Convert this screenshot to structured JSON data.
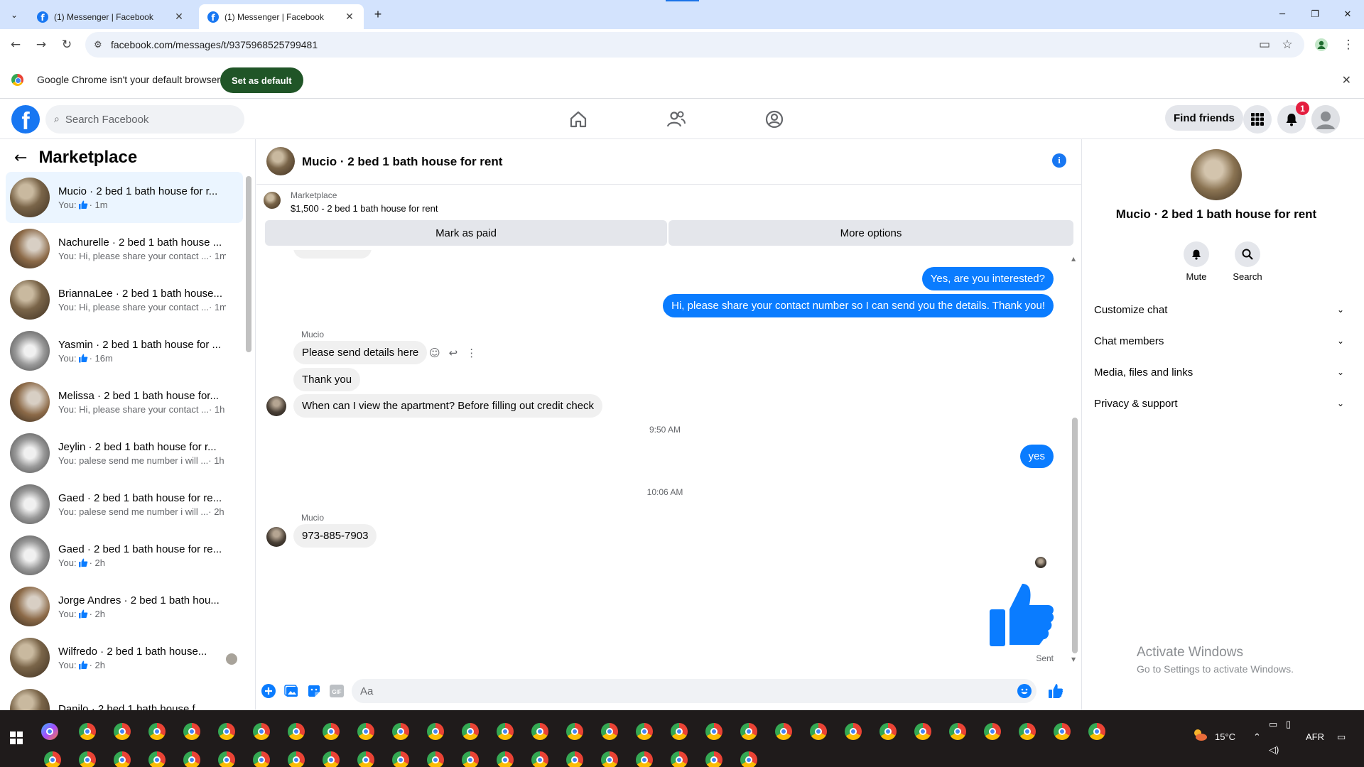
{
  "browser": {
    "tabs": [
      {
        "title": "(1) Messenger | Facebook",
        "active": false
      },
      {
        "title": "(1) Messenger | Facebook",
        "active": true
      }
    ],
    "url": "facebook.com/messages/t/9375968525799481",
    "infobar_text": "Google Chrome isn't your default browser",
    "infobar_button": "Set as default"
  },
  "fb_header": {
    "search_placeholder": "Search Facebook",
    "find_friends": "Find friends",
    "notification_count": "1",
    "brand_color": "#1877f2"
  },
  "sidebar": {
    "title": "Marketplace",
    "conversations": [
      {
        "name": "Mucio · 2 bed 1 bath house for r...",
        "prefix": "You:",
        "like": true,
        "preview": "",
        "time": "· 1m",
        "selected": true
      },
      {
        "name": "Nachurelle · 2 bed 1 bath house ...",
        "prefix": "You: Hi, please share your contact ...",
        "like": false,
        "preview": "",
        "time": "· 1m"
      },
      {
        "name": "BriannaLee · 2 bed 1 bath house...",
        "prefix": "You: Hi, please share your contact ...",
        "like": false,
        "preview": "",
        "time": "· 1m"
      },
      {
        "name": "Yasmin · 2 bed 1 bath house for ...",
        "prefix": "You:",
        "like": true,
        "preview": "",
        "time": "· 16m"
      },
      {
        "name": "Melissa · 2 bed 1 bath house for...",
        "prefix": "You: Hi, please share your contact ...",
        "like": false,
        "preview": "",
        "time": "· 1h"
      },
      {
        "name": "Jeylin · 2 bed 1 bath house for r...",
        "prefix": "You: palese send me number i will ...",
        "like": false,
        "preview": "",
        "time": "· 1h"
      },
      {
        "name": "Gaed · 2 bed 1 bath house for re...",
        "prefix": "You: palese send me number i will ...",
        "like": false,
        "preview": "",
        "time": "· 2h"
      },
      {
        "name": "Gaed · 2 bed 1 bath house for re...",
        "prefix": "You:",
        "like": true,
        "preview": "",
        "time": "· 2h"
      },
      {
        "name": "Jorge Andres · 2 bed 1 bath hou...",
        "prefix": "You:",
        "like": true,
        "preview": "",
        "time": "· 2h"
      },
      {
        "name": "Wilfredo · 2 bed 1 bath house...",
        "prefix": "You:",
        "like": true,
        "preview": "",
        "time": "· 2h"
      },
      {
        "name": "Danilo · 2 bed 1 bath house f...",
        "prefix": "",
        "like": false,
        "preview": "",
        "time": ""
      }
    ]
  },
  "chat": {
    "title": "Mucio · 2 bed 1 bath house for rent",
    "marketplace_label": "Marketplace",
    "listing": "$1,500 - 2 bed 1 bath house for rent",
    "mark_paid": "Mark as paid",
    "more_options": "More options",
    "messages": {
      "out1": "Yes, are you interested?",
      "out2": "Hi, please share your contact number so I can send you the details. Thank you!",
      "sender1": "Mucio",
      "in1": "Please send details here",
      "in2": "Thank you",
      "in3": "When can I view the apartment? Before filling out credit check",
      "time1": "9:50 AM",
      "out3": "yes",
      "time2": "10:06 AM",
      "sender2": "Mucio",
      "in4": "973-885-7903",
      "status": "Sent"
    },
    "composer_placeholder": "Aa",
    "bubble_color": "#0a7cff"
  },
  "right_panel": {
    "name": "Mucio · 2 bed 1 bath house for rent",
    "actions": [
      "Mute",
      "Search"
    ],
    "sections": [
      "Customize chat",
      "Chat members",
      "Media, files and links",
      "Privacy & support"
    ],
    "watermark_title": "Activate Windows",
    "watermark_sub": "Go to Settings to activate Windows."
  },
  "taskbar": {
    "weather": "15°C",
    "language": "AFR"
  }
}
